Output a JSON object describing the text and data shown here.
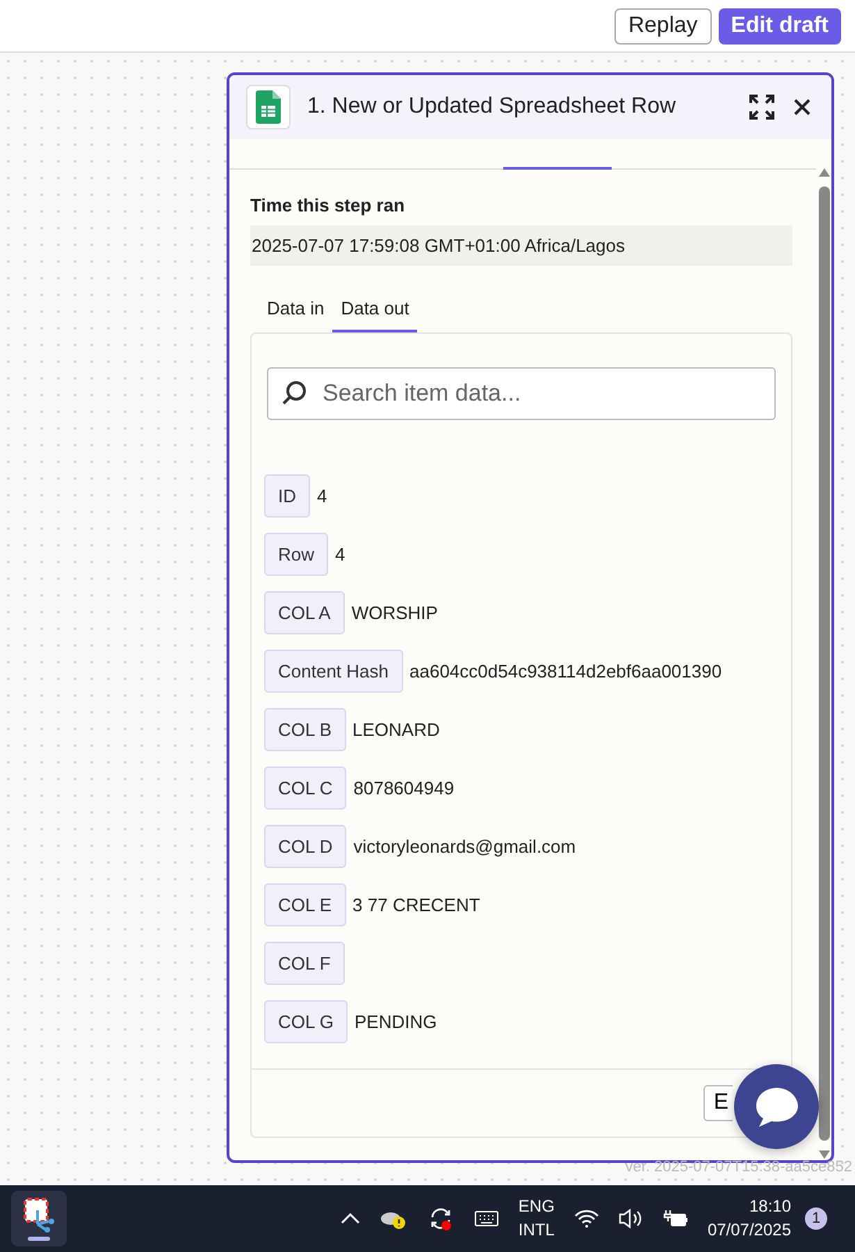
{
  "header": {
    "replay": "Replay",
    "edit_draft": "Edit draft"
  },
  "panel": {
    "title": "1. New or Updated Spreadsheet Row",
    "time_label": "Time this step ran",
    "time_value": "2025-07-07 17:59:08 GMT+01:00 Africa/Lagos",
    "tabs": [
      {
        "label": "Data in",
        "selected": false
      },
      {
        "label": "Data out",
        "selected": true
      }
    ],
    "search": {
      "placeholder": "Search item data..."
    },
    "fields": [
      {
        "key": "ID",
        "value": "4"
      },
      {
        "key": "Row",
        "value": "4"
      },
      {
        "key": "COL A",
        "value": "WORSHIP"
      },
      {
        "key": "Content Hash",
        "value": "aa604cc0d54c938114d2ebf6aa001390"
      },
      {
        "key": "COL B",
        "value": "LEONARD"
      },
      {
        "key": "COL C",
        "value": "8078604949"
      },
      {
        "key": "COL D",
        "value": "victoryleonards@gmail.com"
      },
      {
        "key": "COL E",
        "value": "3 77 CRECENT"
      },
      {
        "key": "COL F"
      },
      {
        "key": "COL G",
        "value": "PENDING"
      }
    ],
    "footer_button": "E"
  },
  "version": "ver. 2025-07-07T15:38-aa5ce852",
  "taskbar": {
    "language": [
      "ENG",
      "INTL"
    ],
    "time": "18:10",
    "date": "07/07/2025",
    "notifications": "1"
  }
}
